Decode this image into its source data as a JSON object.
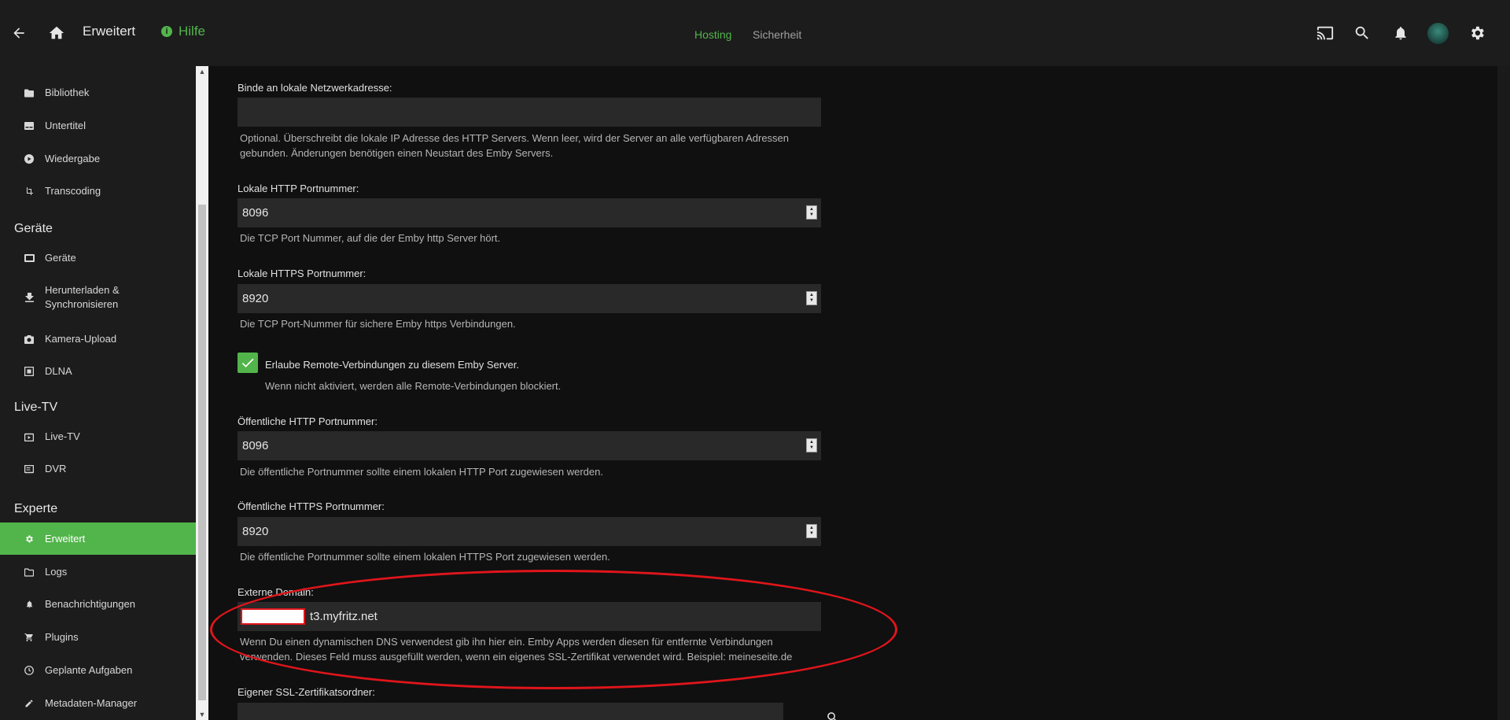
{
  "header": {
    "title": "Erweitert",
    "help_label": "Hilfe",
    "tabs": [
      {
        "label": "Hosting",
        "active": true
      },
      {
        "label": "Sicherheit",
        "active": false
      }
    ],
    "icons": [
      "back-arrow-icon",
      "home-icon",
      "cast-icon",
      "search-icon",
      "bell-icon",
      "gear-icon"
    ],
    "accent": "#52b54b"
  },
  "sidebar": {
    "items_top": [
      {
        "label": "Bibliothek",
        "icon": "folder-icon"
      },
      {
        "label": "Untertitel",
        "icon": "subtitles-icon"
      },
      {
        "label": "Wiedergabe",
        "icon": "play-circle-icon"
      },
      {
        "label": "Transcoding",
        "icon": "transcode-icon"
      }
    ],
    "section_devices": "Geräte",
    "items_devices": [
      {
        "label": "Geräte",
        "icon": "devices-icon"
      },
      {
        "label": "Herunterladen & Synchronisieren",
        "icon": "download-icon"
      },
      {
        "label": "Kamera-Upload",
        "icon": "camera-icon"
      },
      {
        "label": "DLNA",
        "icon": "dlna-icon"
      }
    ],
    "section_livetv": "Live-TV",
    "items_livetv": [
      {
        "label": "Live-TV",
        "icon": "tv-icon"
      },
      {
        "label": "DVR",
        "icon": "dvr-icon"
      }
    ],
    "section_expert": "Experte",
    "items_expert": [
      {
        "label": "Erweitert",
        "icon": "gear-icon",
        "active": true
      },
      {
        "label": "Logs",
        "icon": "folder-outline-icon"
      },
      {
        "label": "Benachrichtigungen",
        "icon": "bell-icon"
      },
      {
        "label": "Plugins",
        "icon": "cart-icon"
      },
      {
        "label": "Geplante Aufgaben",
        "icon": "clock-icon"
      },
      {
        "label": "Metadaten-Manager",
        "icon": "pencil-icon"
      }
    ]
  },
  "form": {
    "bind_label": "Binde an lokale Netzwerkadresse:",
    "bind_value": "",
    "bind_desc": "Optional. Überschreibt die lokale IP Adresse des HTTP Servers. Wenn leer, wird der Server an alle verfügbaren Adressen gebunden. Änderungen benötigen einen Neustart des Emby Servers.",
    "http_label": "Lokale HTTP Portnummer:",
    "http_value": "8096",
    "http_desc": "Die TCP Port Nummer, auf die der Emby http Server hört.",
    "https_label": "Lokale HTTPS Portnummer:",
    "https_value": "8920",
    "https_desc": "Die TCP Port-Nummer für sichere Emby https Verbindungen.",
    "remote_label": "Erlaube Remote-Verbindungen zu diesem Emby Server.",
    "remote_desc": "Wenn nicht aktiviert, werden alle Remote-Verbindungen blockiert.",
    "remote_checked": true,
    "pub_http_label": "Öffentliche HTTP Portnummer:",
    "pub_http_value": "8096",
    "pub_http_desc": "Die öffentliche Portnummer sollte einem lokalen HTTP Port zugewiesen werden.",
    "pub_https_label": "Öffentliche HTTPS Portnummer:",
    "pub_https_value": "8920",
    "pub_https_desc": "Die öffentliche Portnummer sollte einem lokalen HTTPS Port zugewiesen werden.",
    "domain_label": "Externe Domain:",
    "domain_value": "t3.myfritz.net",
    "domain_desc": "Wenn Du einen dynamischen DNS verwendest gib ihn hier ein. Emby Apps werden diesen für entfernte Verbindungen verwenden. Dieses Feld muss ausgefüllt werden, wenn ein eigenes SSL-Zertifikat verwendet wird. Beispiel: meineseite.de",
    "ssl_label": "Eigener SSL-Zertifikatsordner:",
    "ssl_value": ""
  }
}
